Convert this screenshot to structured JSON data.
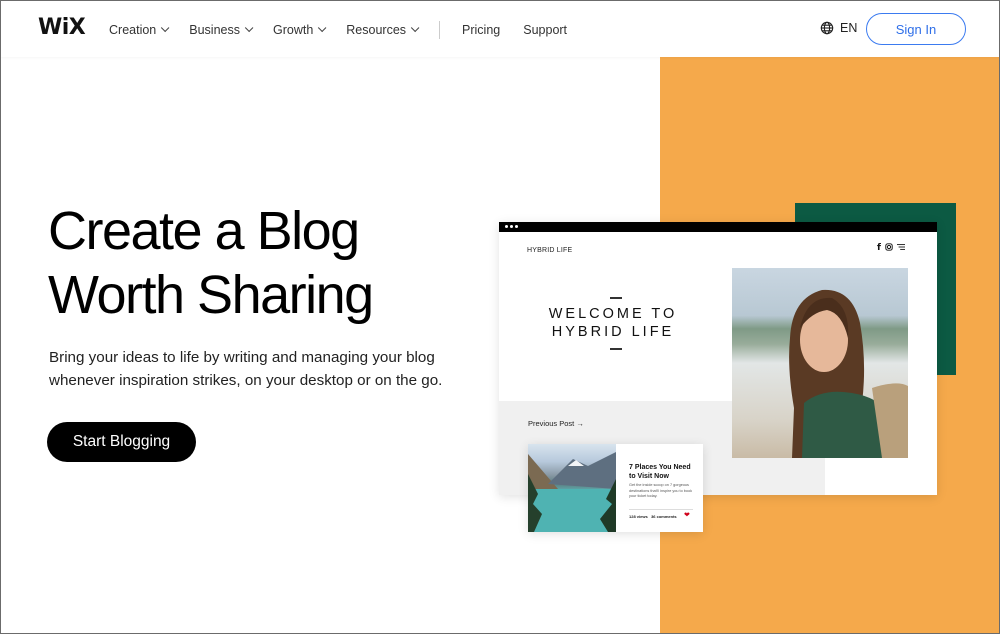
{
  "header": {
    "logo": "WiX",
    "nav": [
      {
        "label": "Creation",
        "has_dropdown": true
      },
      {
        "label": "Business",
        "has_dropdown": true
      },
      {
        "label": "Growth",
        "has_dropdown": true
      },
      {
        "label": "Resources",
        "has_dropdown": true
      }
    ],
    "nav_links": [
      {
        "label": "Pricing"
      },
      {
        "label": "Support"
      }
    ],
    "language": {
      "icon": "globe-icon",
      "label": "EN"
    },
    "sign_in_label": "Sign In"
  },
  "hero": {
    "title_line1": "Create a Blog",
    "title_line2": "Worth Sharing",
    "description": "Bring your ideas to life by writing and managing your blog whenever inspiration strikes, on your desktop or on the go.",
    "cta_label": "Start Blogging"
  },
  "mockup": {
    "site_name": "HYBRID LIFE",
    "social_icons": [
      "facebook-icon",
      "instagram-icon",
      "menu-icon"
    ],
    "welcome_line1": "WELCOME TO",
    "welcome_line2": "HYBRID LIFE",
    "previous_post_label": "Previous Post →",
    "post": {
      "title": "7 Places You Need to Visit Now",
      "excerpt": "Get the inside scoop on 7 gorgeous destinations that'll inspire you to book your ticket today.",
      "views": "128 views",
      "comments": "36 comments"
    }
  },
  "colors": {
    "accent_orange": "#f5a94b",
    "accent_green": "#0c5a43",
    "sign_in_blue": "#2f6fe8",
    "cta_black": "#000000",
    "heart_red": "#d0021b"
  }
}
